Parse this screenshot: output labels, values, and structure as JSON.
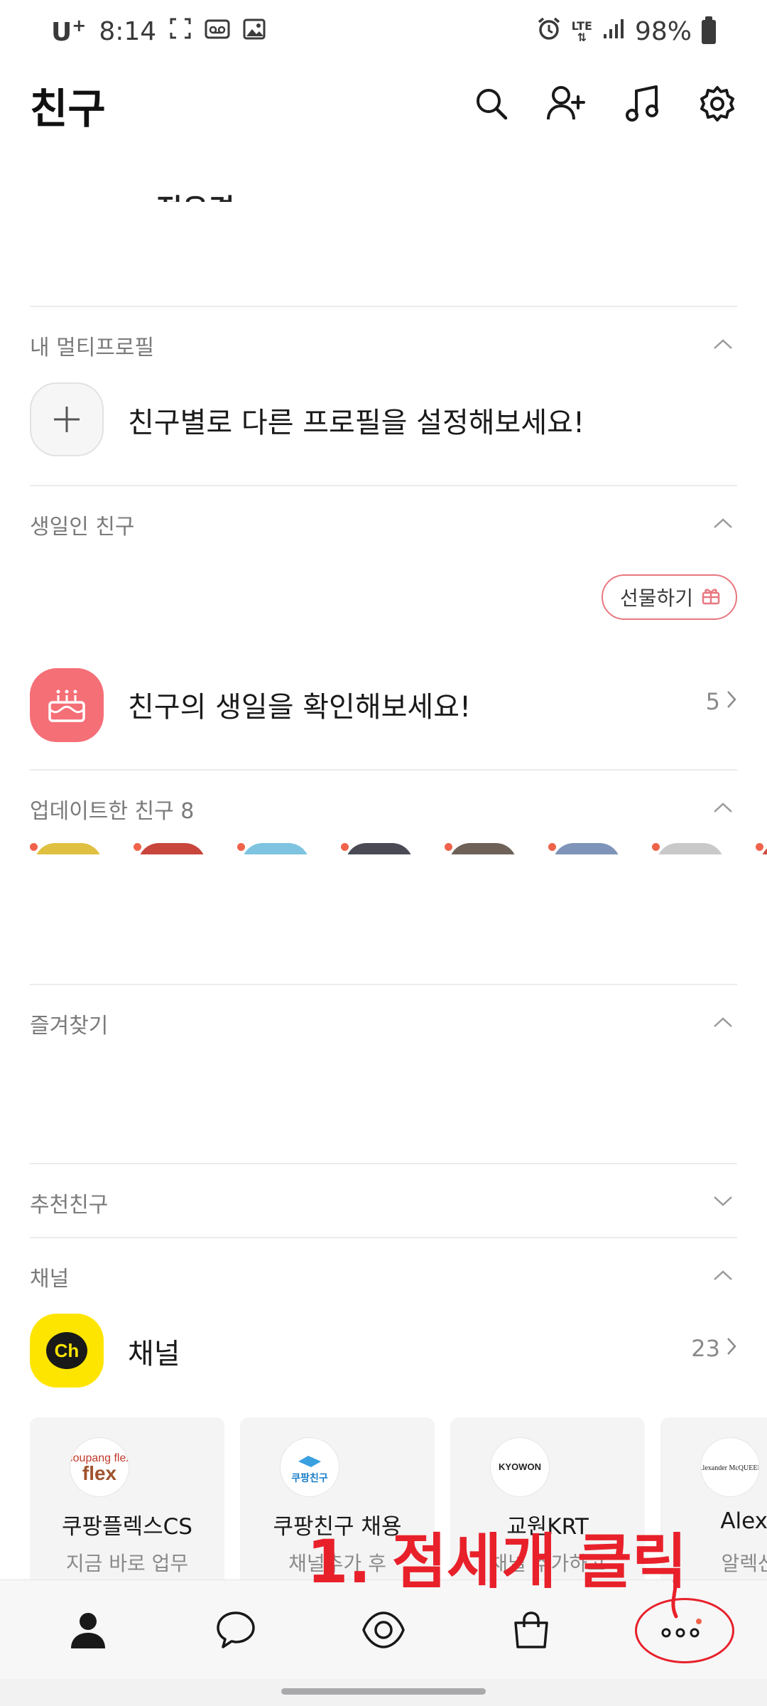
{
  "status_bar": {
    "carrier": "U",
    "carrier_plus": "+",
    "time": "8:14",
    "network": "LTE",
    "battery": "98%"
  },
  "header": {
    "title": "친구"
  },
  "profile": {
    "clipped_name": "정유경"
  },
  "multi_profile": {
    "title": "내 멀티프로필",
    "cta": "친구별로 다른 프로필을 설정해보세요!"
  },
  "birthday": {
    "title": "생일인 친구",
    "gift_label": "선물하기",
    "text": "친구의 생일을 확인해보세요!",
    "count": "5"
  },
  "updated": {
    "title": "업데이트한 친구 8",
    "avatar_colors": [
      "#e0c040",
      "#c8463c",
      "#7ec4e0",
      "#4a4a55",
      "#6e6258",
      "#7e94b8",
      "#c9c9c9",
      "#d05040"
    ]
  },
  "favorites": {
    "title": "즐겨찾기"
  },
  "recommended": {
    "title": "추천친구"
  },
  "channel": {
    "title": "채널",
    "row_label": "채널",
    "count": "23",
    "cards": [
      {
        "name": "쿠팡플렉스CS",
        "desc": "지금 바로 업무",
        "logo": "coupang flex"
      },
      {
        "name": "쿠팡친구 채용",
        "desc": "채널추가 후",
        "logo": "쿠팡친구"
      },
      {
        "name": "교원KRT",
        "desc": "채널 추가하고",
        "logo": "KYOWON"
      },
      {
        "name": "Alexan",
        "desc": "알렉산더",
        "logo": "Alexander McQUEEN"
      }
    ]
  },
  "annotation": {
    "text": "1. 점세개 클릭"
  },
  "colors": {
    "accent_red": "#e8202a",
    "birthday_pink": "#f56f77",
    "channel_yellow": "#fee500"
  }
}
